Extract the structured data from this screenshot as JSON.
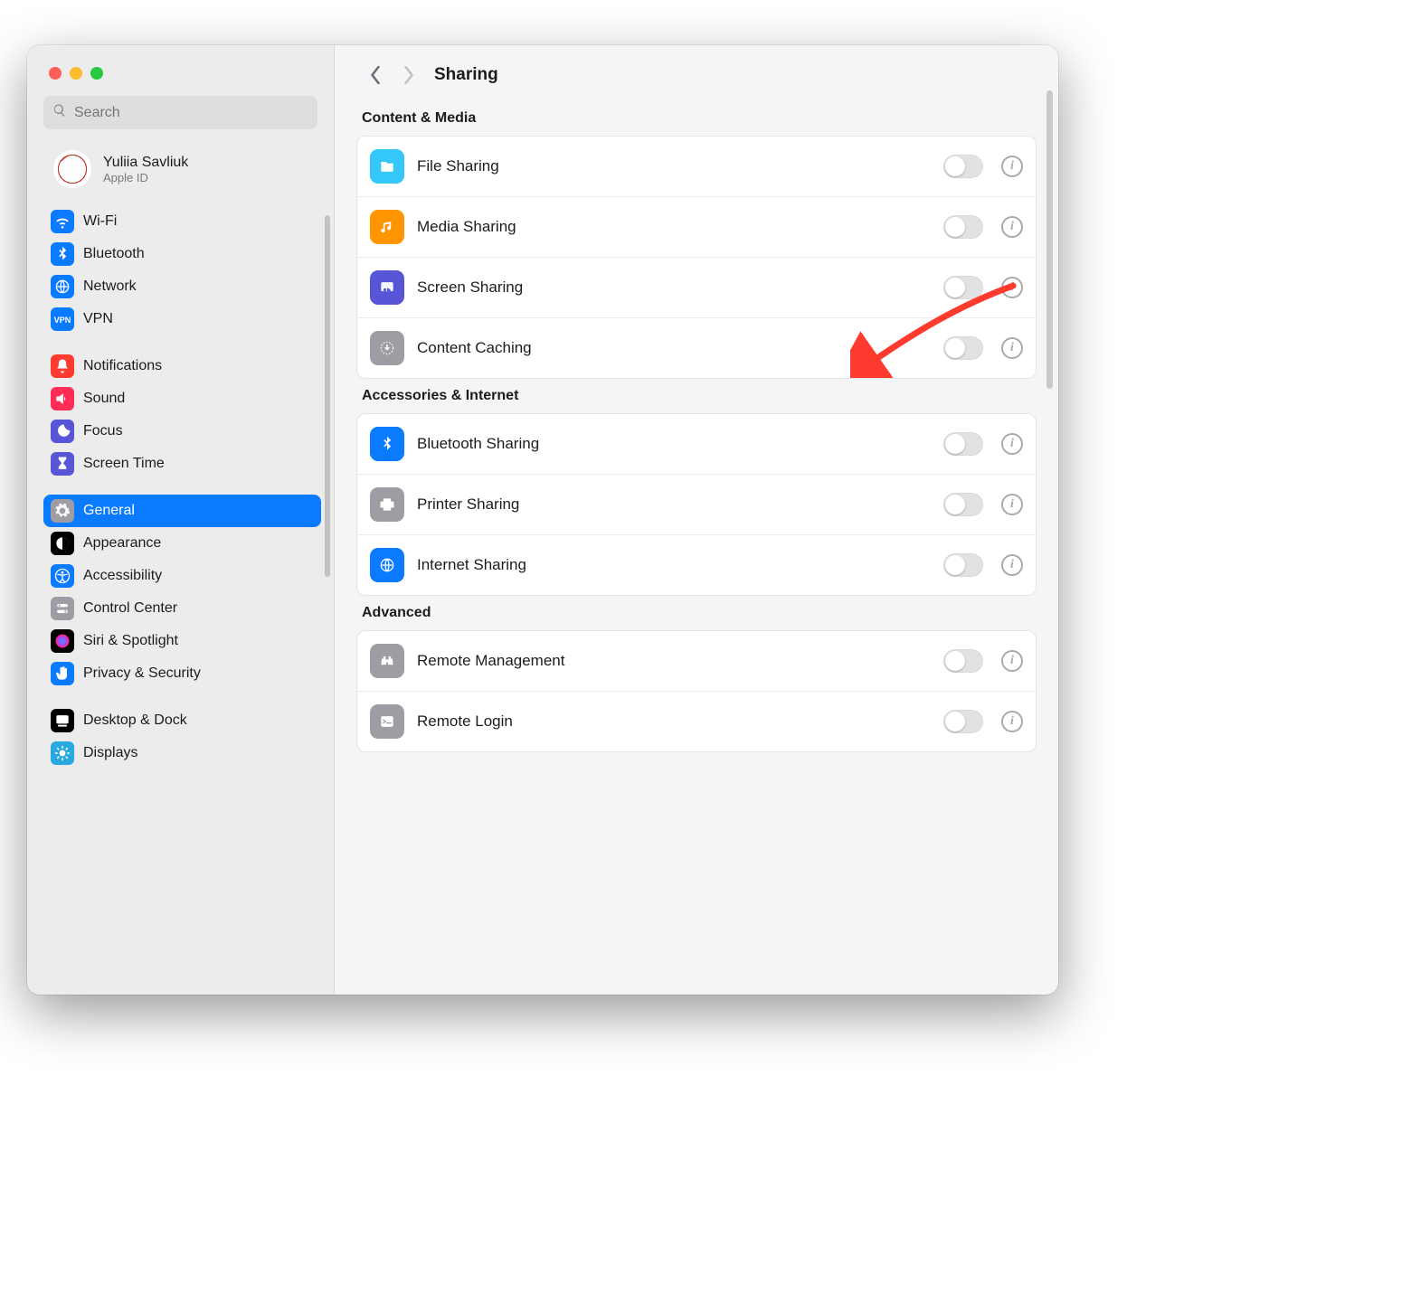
{
  "search": {
    "placeholder": "Search"
  },
  "user": {
    "name": "Yuliia Savliuk",
    "sub": "Apple ID"
  },
  "sidebar": {
    "groups": [
      {
        "items": [
          {
            "label": "Wi-Fi",
            "icon": "wifi",
            "bg": "#0a7aff"
          },
          {
            "label": "Bluetooth",
            "icon": "bluetooth",
            "bg": "#0a7aff"
          },
          {
            "label": "Network",
            "icon": "globe",
            "bg": "#0a7aff"
          },
          {
            "label": "VPN",
            "icon": "vpn",
            "bg": "#0a7aff"
          }
        ]
      },
      {
        "items": [
          {
            "label": "Notifications",
            "icon": "bell",
            "bg": "#ff3b30"
          },
          {
            "label": "Sound",
            "icon": "speaker",
            "bg": "#ff2d55"
          },
          {
            "label": "Focus",
            "icon": "moon",
            "bg": "#5856d6"
          },
          {
            "label": "Screen Time",
            "icon": "hourglass",
            "bg": "#5856d6"
          }
        ]
      },
      {
        "items": [
          {
            "label": "General",
            "icon": "gear",
            "bg": "#9d9da3",
            "selected": true
          },
          {
            "label": "Appearance",
            "icon": "appearance",
            "bg": "#000"
          },
          {
            "label": "Accessibility",
            "icon": "accessibility",
            "bg": "#0a7aff"
          },
          {
            "label": "Control Center",
            "icon": "switches",
            "bg": "#9d9da3"
          },
          {
            "label": "Siri & Spotlight",
            "icon": "siri",
            "bg": "#000"
          },
          {
            "label": "Privacy & Security",
            "icon": "hand",
            "bg": "#0a7aff"
          }
        ]
      },
      {
        "items": [
          {
            "label": "Desktop & Dock",
            "icon": "dock",
            "bg": "#000"
          },
          {
            "label": "Displays",
            "icon": "sun",
            "bg": "#2aa9e0"
          }
        ]
      }
    ]
  },
  "header": {
    "title": "Sharing"
  },
  "sections": [
    {
      "title": "Content & Media",
      "rows": [
        {
          "label": "File Sharing",
          "icon": "folder",
          "bg": "#34c8fa",
          "on": false
        },
        {
          "label": "Media Sharing",
          "icon": "music",
          "bg": "#ff9500",
          "on": false
        },
        {
          "label": "Screen Sharing",
          "icon": "screen",
          "bg": "#5856d6",
          "on": false
        },
        {
          "label": "Content Caching",
          "icon": "download-circle",
          "bg": "#9d9da3",
          "on": false
        }
      ]
    },
    {
      "title": "Accessories & Internet",
      "rows": [
        {
          "label": "Bluetooth Sharing",
          "icon": "bluetooth",
          "bg": "#0a7aff",
          "on": false
        },
        {
          "label": "Printer Sharing",
          "icon": "printer",
          "bg": "#9d9da3",
          "on": false
        },
        {
          "label": "Internet Sharing",
          "icon": "globe",
          "bg": "#0a7aff",
          "on": false
        }
      ]
    },
    {
      "title": "Advanced",
      "rows": [
        {
          "label": "Remote Management",
          "icon": "binoculars",
          "bg": "#9d9da3",
          "on": false
        },
        {
          "label": "Remote Login",
          "icon": "terminal",
          "bg": "#9d9da3",
          "on": false
        }
      ]
    }
  ]
}
